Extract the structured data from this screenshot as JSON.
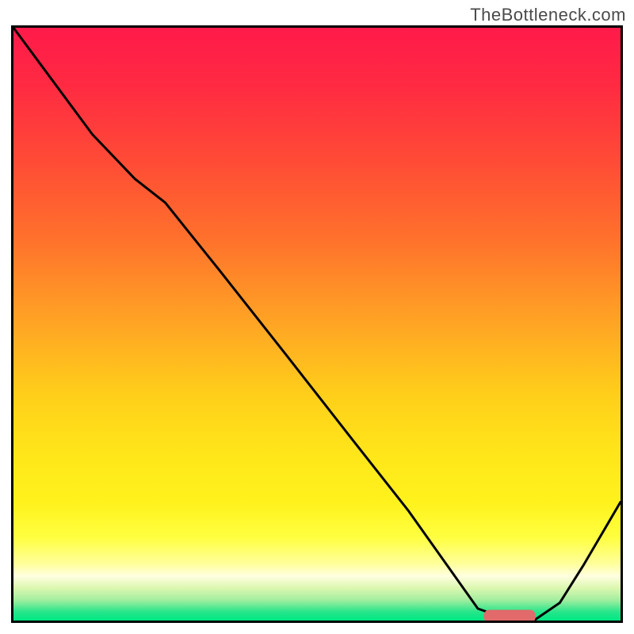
{
  "watermark": "TheBottleneck.com",
  "gradient": {
    "stops": [
      {
        "offset": 0.0,
        "color": "#ff1a4a"
      },
      {
        "offset": 0.1,
        "color": "#ff2b42"
      },
      {
        "offset": 0.22,
        "color": "#ff4a36"
      },
      {
        "offset": 0.35,
        "color": "#ff6f2c"
      },
      {
        "offset": 0.5,
        "color": "#ffa524"
      },
      {
        "offset": 0.62,
        "color": "#ffcf1a"
      },
      {
        "offset": 0.72,
        "color": "#ffe61a"
      },
      {
        "offset": 0.8,
        "color": "#fff21c"
      },
      {
        "offset": 0.86,
        "color": "#ffff40"
      },
      {
        "offset": 0.905,
        "color": "#ffff9e"
      },
      {
        "offset": 0.925,
        "color": "#ffffe0"
      },
      {
        "offset": 0.945,
        "color": "#dcf7b0"
      },
      {
        "offset": 0.965,
        "color": "#a4eea0"
      },
      {
        "offset": 0.986,
        "color": "#24e58a"
      },
      {
        "offset": 1.0,
        "color": "#00e884"
      }
    ]
  },
  "chart_data": {
    "type": "line",
    "title": "",
    "xlabel": "",
    "ylabel": "",
    "xlim": [
      0,
      100
    ],
    "ylim": [
      0,
      100
    ],
    "series": [
      {
        "name": "bottleneck-curve",
        "x": [
          0.0,
          6.5,
          13.0,
          20.0,
          25.0,
          34.0,
          45.0,
          56.0,
          65.0,
          72.0,
          76.5,
          81.5,
          86.0,
          90.0,
          94.0,
          100.0
        ],
        "y": [
          100.0,
          91.0,
          82.0,
          74.5,
          70.5,
          59.0,
          44.7,
          30.3,
          18.6,
          8.5,
          2.0,
          0.2,
          0.2,
          3.0,
          9.5,
          20.0
        ]
      }
    ],
    "marker": {
      "name": "optimal-range",
      "shape": "rounded-bar",
      "color": "#e26a6a",
      "x_start": 77.5,
      "x_end": 86.0,
      "y": 0.7,
      "height": 2.2
    }
  }
}
